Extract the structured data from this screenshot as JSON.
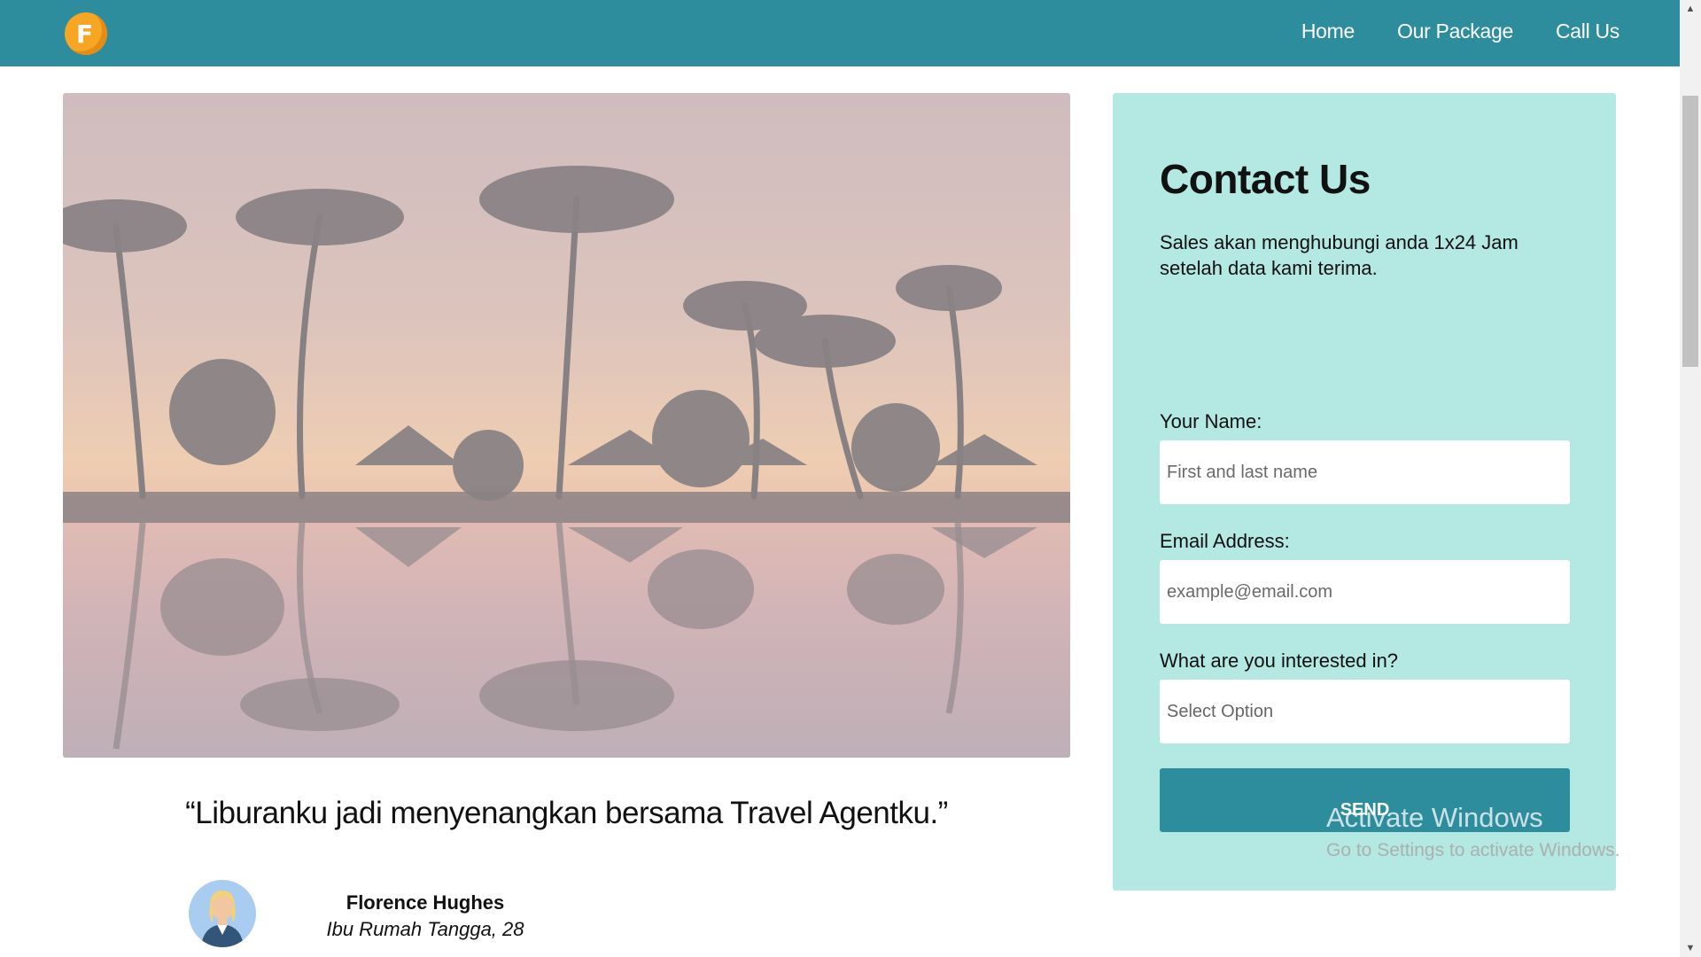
{
  "nav": {
    "logo_letter": "F",
    "links": [
      "Home",
      "Our Package",
      "Call Us"
    ]
  },
  "hero": {
    "image": "tropical-sunset-palm-trees-reflection"
  },
  "testimonial": {
    "quote": "“Liburanku jadi menyenangkan bersama Travel Agentku.”",
    "author_name": "Florence Hughes",
    "author_role": "Ibu Rumah Tangga, 28"
  },
  "contact": {
    "title": "Contact Us",
    "description": "Sales akan menghubungi anda 1x24 Jam setelah data kami terima.",
    "name_label": "Your Name:",
    "name_placeholder": "First and last name",
    "email_label": "Email Address:",
    "email_placeholder": "example@email.com",
    "interest_label": "What are you interested in?",
    "interest_selected": "Select Option",
    "send_label": "SEND"
  },
  "watermark": {
    "title": "Activate Windows",
    "subtitle": "Go to Settings to activate Windows."
  },
  "colors": {
    "primary": "#2d8d9c",
    "panel": "#b3e8e3",
    "logo": "#f6a623"
  }
}
